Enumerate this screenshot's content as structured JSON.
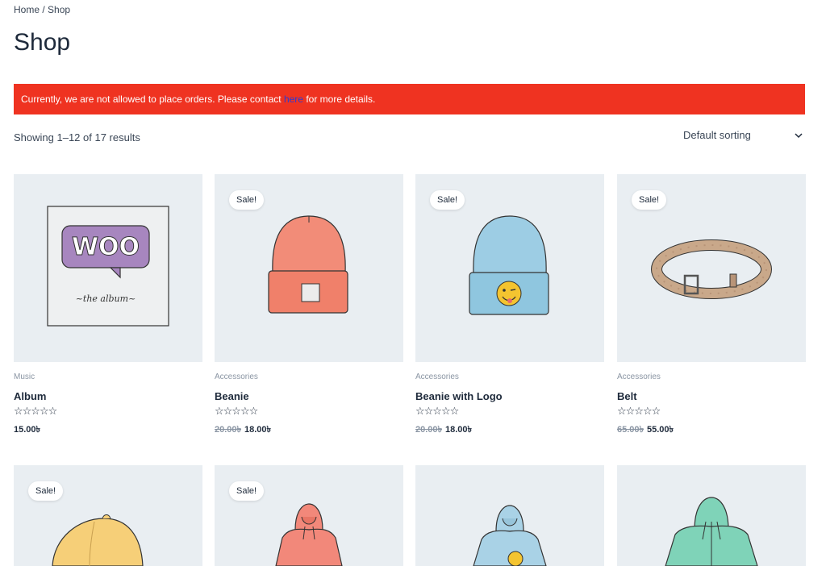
{
  "breadcrumb": {
    "home": "Home",
    "separator": " / ",
    "current": "Shop"
  },
  "page_title": "Shop",
  "notice": {
    "text_before": "Currently, we are not allowed to place orders. Please contact ",
    "link": "here",
    "text_after": " for more details.",
    "color": "#ef3321"
  },
  "result_count": "Showing 1–12 of 17 results",
  "sorting": {
    "selected": "Default sorting"
  },
  "sale_label": "Sale!",
  "stars": "☆☆☆☆☆",
  "products": [
    {
      "category": "Music",
      "name": "Album",
      "price": "15.00৳",
      "old_price": ""
    },
    {
      "category": "Accessories",
      "name": "Beanie",
      "price": "18.00৳",
      "old_price": "20.00৳"
    },
    {
      "category": "Accessories",
      "name": "Beanie with Logo",
      "price": "18.00৳",
      "old_price": "20.00৳"
    },
    {
      "category": "Accessories",
      "name": "Belt",
      "price": "55.00৳",
      "old_price": "65.00৳"
    }
  ],
  "album_art": {
    "logo": "WOO",
    "subtitle": "~the album~"
  }
}
